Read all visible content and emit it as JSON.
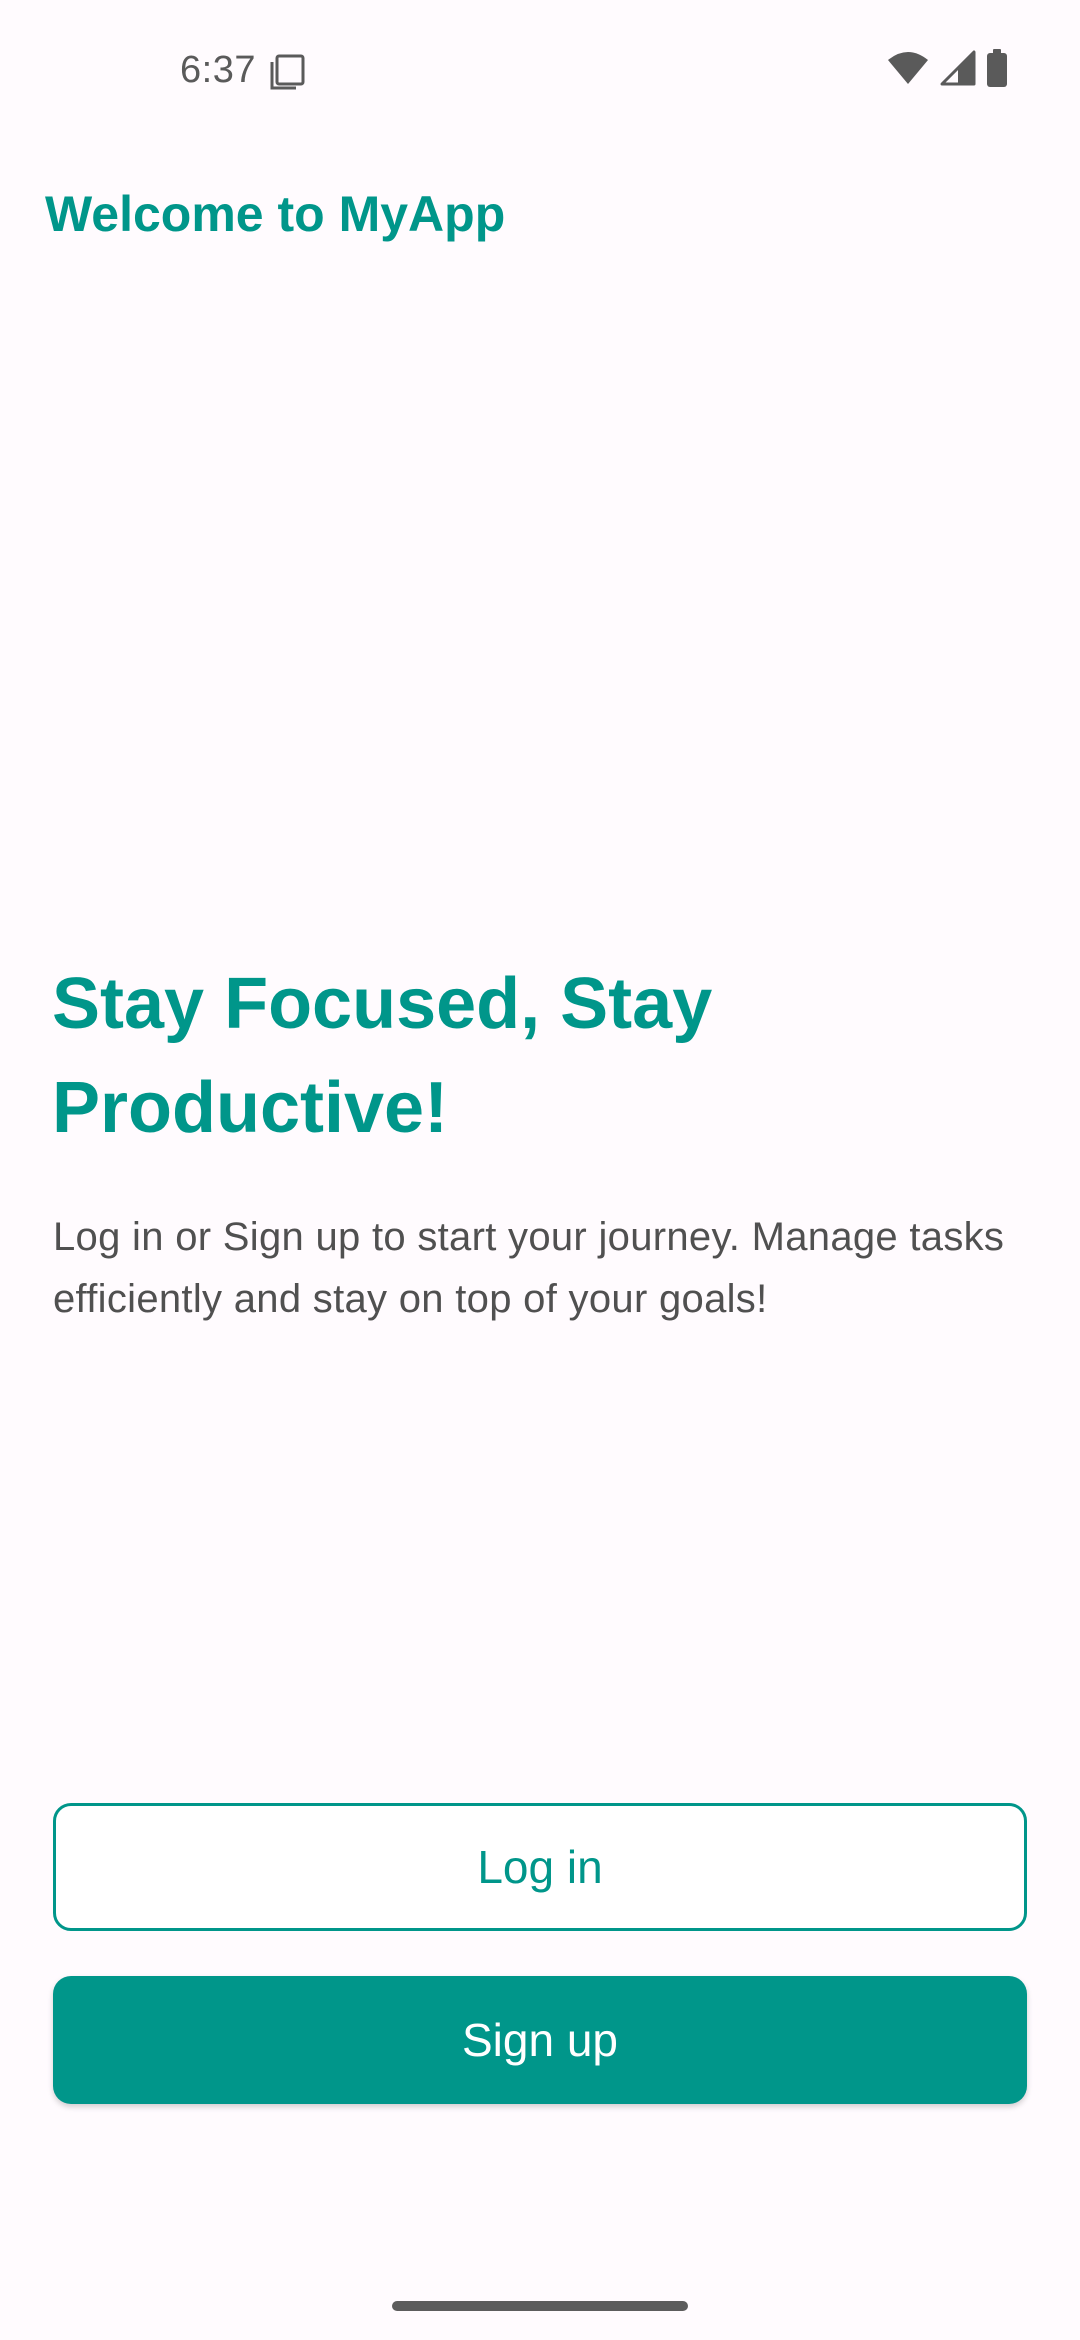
{
  "status_bar": {
    "time": "6:37",
    "icons": [
      "notification-icon",
      "wifi-icon",
      "signal-icon",
      "battery-icon"
    ]
  },
  "app_bar": {
    "title": "Welcome to MyApp"
  },
  "hero": {
    "heading": "Stay Focused, Stay Productive!",
    "body": "Log in or Sign up to start your journey. Manage tasks efficiently and stay on top of your goals!"
  },
  "actions": {
    "login_label": "Log in",
    "signup_label": "Sign up"
  },
  "colors": {
    "accent": "#00968a",
    "background": "#fffbfe",
    "body_text": "#505050"
  }
}
